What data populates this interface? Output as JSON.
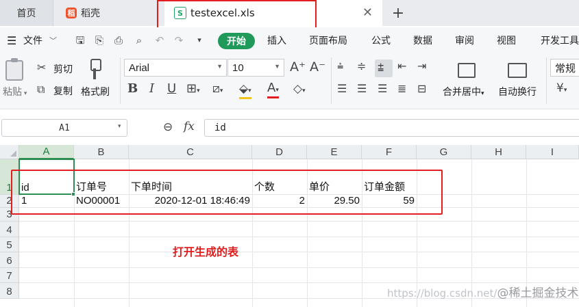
{
  "tabs": {
    "home": "首页",
    "docer_logo": "稻",
    "docer": "稻壳",
    "file": "testexcel.xls",
    "file_icon_letter": "S",
    "close_glyph": "✕",
    "add_glyph": "+"
  },
  "menu": {
    "file": "文件",
    "items": [
      "开始",
      "插入",
      "页面布局",
      "公式",
      "数据",
      "审阅",
      "视图",
      "开发工具"
    ],
    "active": "开始"
  },
  "ribbon": {
    "paste": "粘贴",
    "cut": "剪切",
    "copy": "复制",
    "format_painter": "格式刷",
    "font_name": "Arial",
    "font_size": "10",
    "merge_center": "合并居中",
    "wrap_text": "自动换行",
    "number_format": "常规",
    "currency_glyph": "¥"
  },
  "formula_bar": {
    "name_box": "A1",
    "fx": "fx",
    "content": "id"
  },
  "sheet": {
    "columns": [
      "A",
      "B",
      "C",
      "D",
      "E",
      "F",
      "G",
      "H",
      "I"
    ],
    "rows": [
      "1",
      "2",
      "3",
      "4",
      "5",
      "6",
      "7",
      "8"
    ],
    "selected_column": "A",
    "selected_row": "1",
    "header_row": [
      "id",
      "订单号",
      "下单时间",
      "个数",
      "单价",
      "订单金额"
    ],
    "data_row": [
      "1",
      "NO00001",
      "2020-12-01 18:46:49",
      "2",
      "29.50",
      "59"
    ]
  },
  "annotation": "打开生成的表",
  "watermark": {
    "url": "https://blog.csdn.net/",
    "brand": "@稀土掘金技术社区"
  },
  "colors": {
    "accent_green": "#1f9a5a",
    "highlight_red": "#e11d1d",
    "selection_green": "#2d8c4f"
  }
}
